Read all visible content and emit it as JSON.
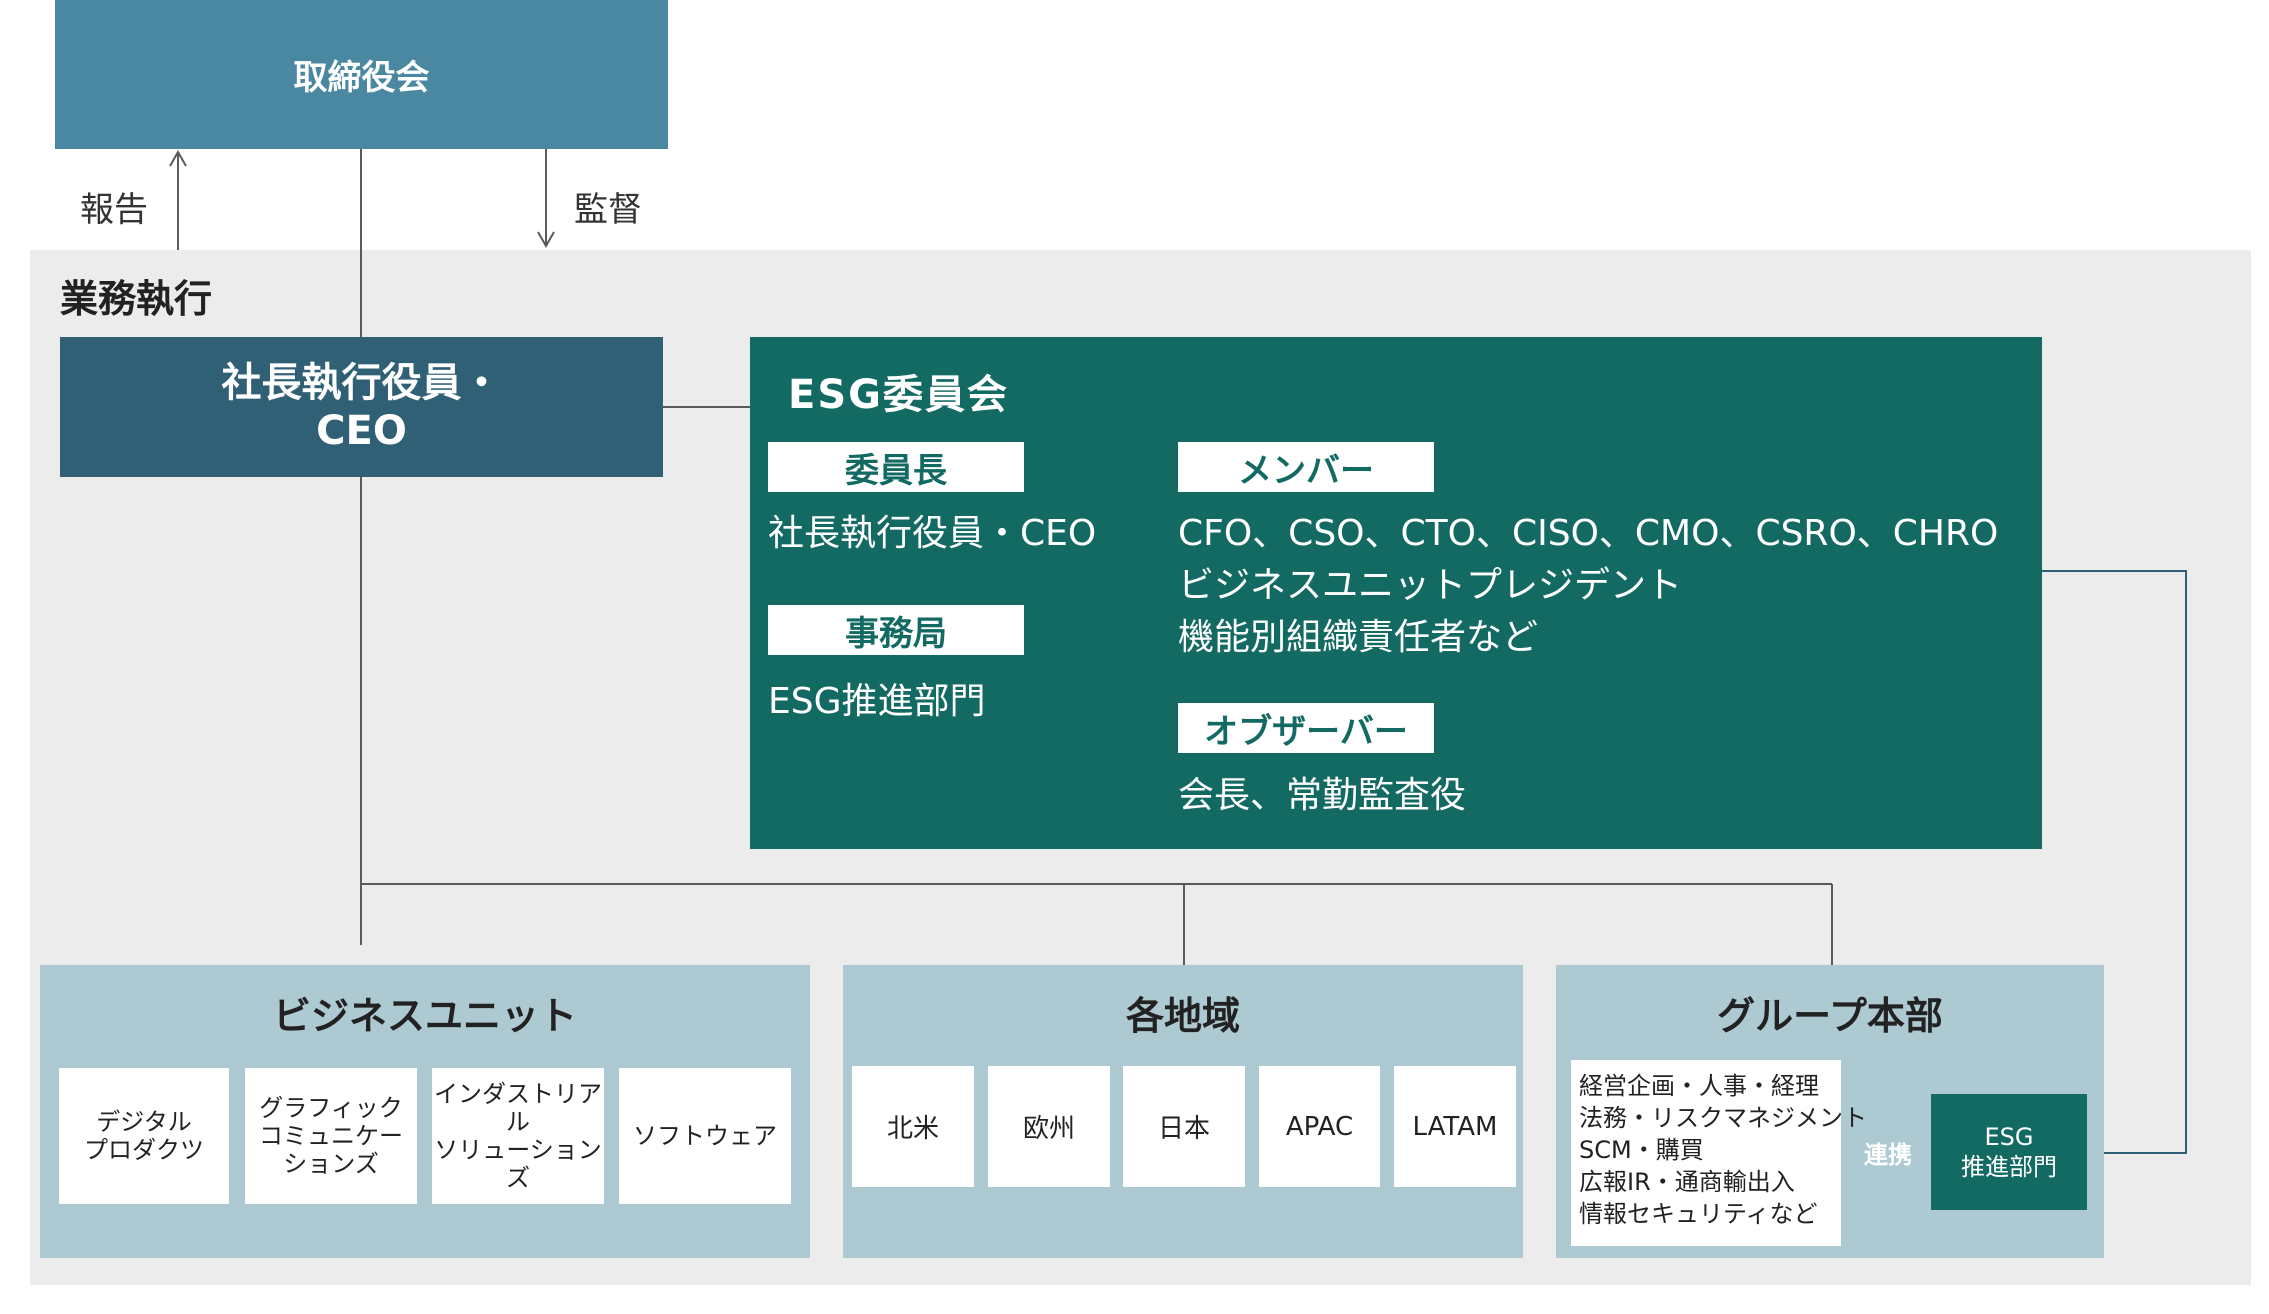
{
  "board": {
    "label": "取締役会"
  },
  "arrows": {
    "report": "報告",
    "supervise": "監督"
  },
  "section": {
    "label": "業務執行"
  },
  "ceo": {
    "line1": "社長執行役員・",
    "line2": "CEO"
  },
  "esg_committee": {
    "title": "ESG委員会",
    "chair": {
      "tag": "委員長",
      "text": "社長執行役員・CEO"
    },
    "secretariat": {
      "tag": "事務局",
      "text": "ESG推進部門"
    },
    "members": {
      "tag": "メンバー",
      "lines": [
        "CFO、CSO、CTO、CISO、CMO、CSRO、CHRO",
        "ビジネスユニットプレジデント",
        "機能別組織責任者など"
      ]
    },
    "observers": {
      "tag": "オブザーバー",
      "text": "会長、常勤監査役"
    }
  },
  "business_units": {
    "title": "ビジネスユニット",
    "items": [
      {
        "lines": [
          "デジタル",
          "プロダクツ"
        ]
      },
      {
        "lines": [
          "グラフィック",
          "コミュニケー",
          "ションズ"
        ]
      },
      {
        "lines": [
          "インダストリアル",
          "ソリューションズ"
        ]
      },
      {
        "lines": [
          "ソフトウェア"
        ]
      }
    ]
  },
  "regions": {
    "title": "各地域",
    "items": [
      "北米",
      "欧州",
      "日本",
      "APAC",
      "LATAM"
    ]
  },
  "group_hq": {
    "title": "グループ本部",
    "functions": [
      "経営企画・人事・経理",
      "法務・リスクマネジメント",
      "SCM・購買",
      "広報IR・通商輸出入",
      "情報セキュリティなど"
    ],
    "link_label": "連携",
    "esg_unit": {
      "line1": "ESG",
      "line2": "推進部門"
    }
  },
  "colors": {
    "board": "#4a88a2",
    "ceo": "#2f6076",
    "esg": "#136a63",
    "panel": "#adc9d2",
    "background": "#ececec",
    "arrow": "#7a7a7a"
  }
}
